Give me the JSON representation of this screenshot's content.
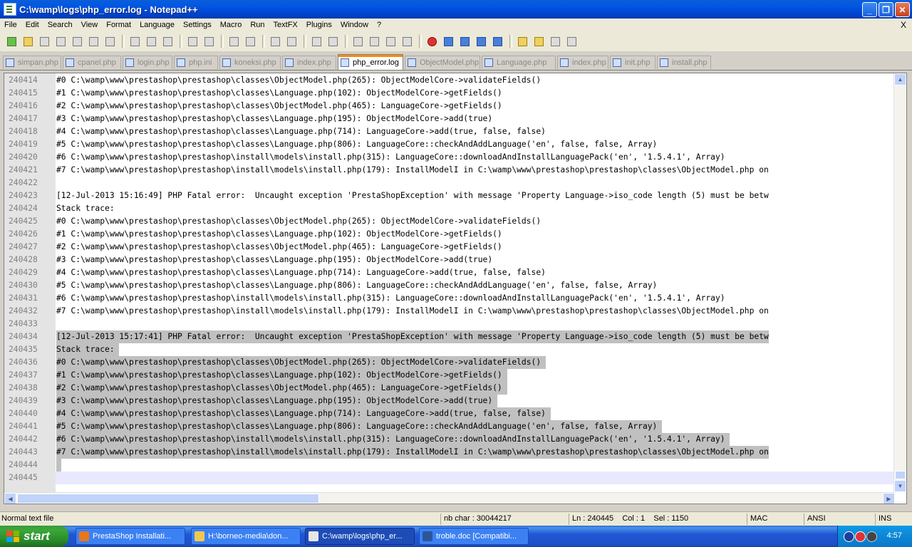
{
  "window": {
    "title": "C:\\wamp\\logs\\php_error.log - Notepad++",
    "buttons": {
      "minimize": "_",
      "maximize": "❐",
      "close": "✕"
    }
  },
  "menu": {
    "items": [
      "File",
      "Edit",
      "Search",
      "View",
      "Format",
      "Language",
      "Settings",
      "Macro",
      "Run",
      "TextFX",
      "Plugins",
      "Window",
      "?"
    ],
    "close": "X"
  },
  "toolbar": {
    "icons": [
      "new-file-icon",
      "open-file-icon",
      "save-icon",
      "save-all-icon",
      "close-icon",
      "close-all-icon",
      "print-icon",
      "cut-icon",
      "copy-icon",
      "paste-icon",
      "undo-icon",
      "redo-icon",
      "find-icon",
      "replace-icon",
      "zoom-in-icon",
      "zoom-out-icon",
      "sync-vertical-icon",
      "sync-horizontal-icon",
      "word-wrap-icon",
      "show-all-chars-icon",
      "indent-guide-icon",
      "user-language-icon",
      "record-macro-icon",
      "stop-record-icon",
      "play-macro-icon",
      "run-macro-multiple-icon",
      "save-macro-icon",
      "folder-icon",
      "open-folder-icon",
      "terminal-icon",
      "spellcheck-icon"
    ]
  },
  "tabs": [
    {
      "label": "simpan.php",
      "active": false
    },
    {
      "label": "cpanel.php",
      "active": false
    },
    {
      "label": "login.php",
      "active": false
    },
    {
      "label": "php.ini",
      "active": false
    },
    {
      "label": "koneksi.php",
      "active": false
    },
    {
      "label": "index.php",
      "active": false
    },
    {
      "label": "php_error.log",
      "active": true
    },
    {
      "label": "ObjectModel.php",
      "active": false
    },
    {
      "label": "Language.php",
      "active": false
    },
    {
      "label": "index.php",
      "active": false
    },
    {
      "label": "init.php",
      "active": false
    },
    {
      "label": "install.php",
      "active": false
    }
  ],
  "editor": {
    "lines": [
      {
        "n": "240414",
        "t": "#0 C:\\wamp\\www\\prestashop\\prestashop\\classes\\ObjectModel.php(265): ObjectModelCore->validateFields()",
        "sel": false
      },
      {
        "n": "240415",
        "t": "#1 C:\\wamp\\www\\prestashop\\prestashop\\classes\\Language.php(102): ObjectModelCore->getFields()",
        "sel": false
      },
      {
        "n": "240416",
        "t": "#2 C:\\wamp\\www\\prestashop\\prestashop\\classes\\ObjectModel.php(465): LanguageCore->getFields()",
        "sel": false
      },
      {
        "n": "240417",
        "t": "#3 C:\\wamp\\www\\prestashop\\prestashop\\classes\\Language.php(195): ObjectModelCore->add(true)",
        "sel": false
      },
      {
        "n": "240418",
        "t": "#4 C:\\wamp\\www\\prestashop\\prestashop\\classes\\Language.php(714): LanguageCore->add(true, false, false)",
        "sel": false
      },
      {
        "n": "240419",
        "t": "#5 C:\\wamp\\www\\prestashop\\prestashop\\classes\\Language.php(806): LanguageCore::checkAndAddLanguage('en', false, false, Array)",
        "sel": false
      },
      {
        "n": "240420",
        "t": "#6 C:\\wamp\\www\\prestashop\\prestashop\\install\\models\\install.php(315): LanguageCore::downloadAndInstallLanguagePack('en', '1.5.4.1', Array)",
        "sel": false
      },
      {
        "n": "240421",
        "t": "#7 C:\\wamp\\www\\prestashop\\prestashop\\install\\models\\install.php(179): InstallModelI in C:\\wamp\\www\\prestashop\\prestashop\\classes\\ObjectModel.php on",
        "sel": false
      },
      {
        "n": "240422",
        "t": "",
        "sel": false
      },
      {
        "n": "240423",
        "t": "[12-Jul-2013 15:16:49] PHP Fatal error:  Uncaught exception 'PrestaShopException' with message 'Property Language->iso_code length (5) must be betw",
        "sel": false
      },
      {
        "n": "240424",
        "t": "Stack trace:",
        "sel": false
      },
      {
        "n": "240425",
        "t": "#0 C:\\wamp\\www\\prestashop\\prestashop\\classes\\ObjectModel.php(265): ObjectModelCore->validateFields()",
        "sel": false
      },
      {
        "n": "240426",
        "t": "#1 C:\\wamp\\www\\prestashop\\prestashop\\classes\\Language.php(102): ObjectModelCore->getFields()",
        "sel": false
      },
      {
        "n": "240427",
        "t": "#2 C:\\wamp\\www\\prestashop\\prestashop\\classes\\ObjectModel.php(465): LanguageCore->getFields()",
        "sel": false
      },
      {
        "n": "240428",
        "t": "#3 C:\\wamp\\www\\prestashop\\prestashop\\classes\\Language.php(195): ObjectModelCore->add(true)",
        "sel": false
      },
      {
        "n": "240429",
        "t": "#4 C:\\wamp\\www\\prestashop\\prestashop\\classes\\Language.php(714): LanguageCore->add(true, false, false)",
        "sel": false
      },
      {
        "n": "240430",
        "t": "#5 C:\\wamp\\www\\prestashop\\prestashop\\classes\\Language.php(806): LanguageCore::checkAndAddLanguage('en', false, false, Array)",
        "sel": false
      },
      {
        "n": "240431",
        "t": "#6 C:\\wamp\\www\\prestashop\\prestashop\\install\\models\\install.php(315): LanguageCore::downloadAndInstallLanguagePack('en', '1.5.4.1', Array)",
        "sel": false
      },
      {
        "n": "240432",
        "t": "#7 C:\\wamp\\www\\prestashop\\prestashop\\install\\models\\install.php(179): InstallModelI in C:\\wamp\\www\\prestashop\\prestashop\\classes\\ObjectModel.php on",
        "sel": false
      },
      {
        "n": "240433",
        "t": "",
        "sel": false
      },
      {
        "n": "240434",
        "t": "[12-Jul-2013 15:17:41] PHP Fatal error:  Uncaught exception 'PrestaShopException' with message 'Property Language->iso_code length (5) must be betw",
        "sel": true
      },
      {
        "n": "240435",
        "t": "Stack trace: ",
        "sel": true
      },
      {
        "n": "240436",
        "t": "#0 C:\\wamp\\www\\prestashop\\prestashop\\classes\\ObjectModel.php(265): ObjectModelCore->validateFields() ",
        "sel": true
      },
      {
        "n": "240437",
        "t": "#1 C:\\wamp\\www\\prestashop\\prestashop\\classes\\Language.php(102): ObjectModelCore->getFields() ",
        "sel": true
      },
      {
        "n": "240438",
        "t": "#2 C:\\wamp\\www\\prestashop\\prestashop\\classes\\ObjectModel.php(465): LanguageCore->getFields() ",
        "sel": true
      },
      {
        "n": "240439",
        "t": "#3 C:\\wamp\\www\\prestashop\\prestashop\\classes\\Language.php(195): ObjectModelCore->add(true) ",
        "sel": true
      },
      {
        "n": "240440",
        "t": "#4 C:\\wamp\\www\\prestashop\\prestashop\\classes\\Language.php(714): LanguageCore->add(true, false, false) ",
        "sel": true
      },
      {
        "n": "240441",
        "t": "#5 C:\\wamp\\www\\prestashop\\prestashop\\classes\\Language.php(806): LanguageCore::checkAndAddLanguage('en', false, false, Array) ",
        "sel": true
      },
      {
        "n": "240442",
        "t": "#6 C:\\wamp\\www\\prestashop\\prestashop\\install\\models\\install.php(315): LanguageCore::downloadAndInstallLanguagePack('en', '1.5.4.1', Array) ",
        "sel": true
      },
      {
        "n": "240443",
        "t": "#7 C:\\wamp\\www\\prestashop\\prestashop\\install\\models\\install.php(179): InstallModelI in C:\\wamp\\www\\prestashop\\prestashop\\classes\\ObjectModel.php on",
        "sel": true
      },
      {
        "n": "240444",
        "t": " ",
        "sel": true
      },
      {
        "n": "240445",
        "t": "",
        "sel": false,
        "cur": true
      }
    ]
  },
  "status": {
    "filetype": "Normal text file",
    "chars": "nb char : 30044217",
    "position": "Ln : 240445    Col : 1    Sel : 1150",
    "eol": "MAC",
    "encoding": "ANSI",
    "mode": "INS"
  },
  "taskbar": {
    "start": "start",
    "buttons": [
      {
        "label": "PrestaShop Installati...",
        "icon": "firefox-icon",
        "color": "#e8761c"
      },
      {
        "label": "H:\\borneo-media\\don...",
        "icon": "folder-icon",
        "color": "#f0c850"
      },
      {
        "label": "C:\\wamp\\logs\\php_er...",
        "icon": "notepad-icon",
        "color": "#e6e6e6",
        "active": true
      },
      {
        "label": "troble.doc [Compatibi...",
        "icon": "word-doc-icon",
        "color": "#2b579a"
      }
    ],
    "clock": "4:57"
  }
}
